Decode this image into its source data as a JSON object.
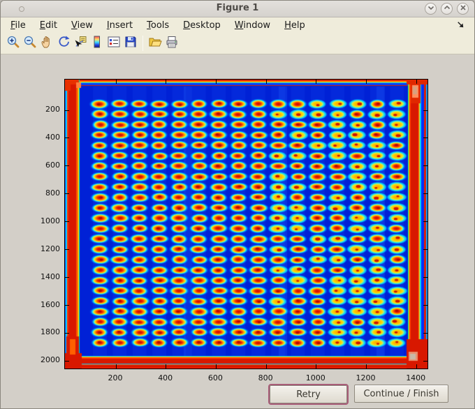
{
  "window": {
    "title": "Figure 1",
    "controls": [
      "chevron-down",
      "chevron-up",
      "close"
    ]
  },
  "menubar": {
    "items": [
      "File",
      "Edit",
      "View",
      "Insert",
      "Tools",
      "Desktop",
      "Window",
      "Help"
    ],
    "dock_icon": "dock-arrow"
  },
  "toolbar": {
    "icons": [
      "zoom-in",
      "zoom-out",
      "pan",
      "rotate-3d",
      "data-cursor",
      "insert-colorbar",
      "insert-legend",
      "save-figure",
      "open-file",
      "print-figure"
    ]
  },
  "figure": {
    "x_ticks": [
      "200",
      "400",
      "600",
      "800",
      "1000",
      "1200",
      "1400"
    ],
    "y_ticks": [
      "200",
      "400",
      "600",
      "800",
      "1000",
      "1200",
      "1400",
      "1600",
      "1800",
      "2000"
    ],
    "image_description": "microplate scan, jet colormap",
    "plate": {
      "rows": 24,
      "cols": 16,
      "colors": {
        "background": "#0021d6",
        "well_core": "#d81400",
        "well_ring": "#ffd800",
        "well_mid": "#ff8800",
        "well_halo": "#00d8ff",
        "border_band": "#d81800"
      }
    }
  },
  "action_buttons": [
    {
      "label": "Retry",
      "focused": true
    },
    {
      "label": "Continue / Finish",
      "focused": false
    }
  ],
  "theme": {
    "chrome_beige": "#efecdb",
    "canvas_gray": "#d3cfc8",
    "titlebar_gray": "#dcd9d4",
    "focus_ring": "#a85c78"
  }
}
